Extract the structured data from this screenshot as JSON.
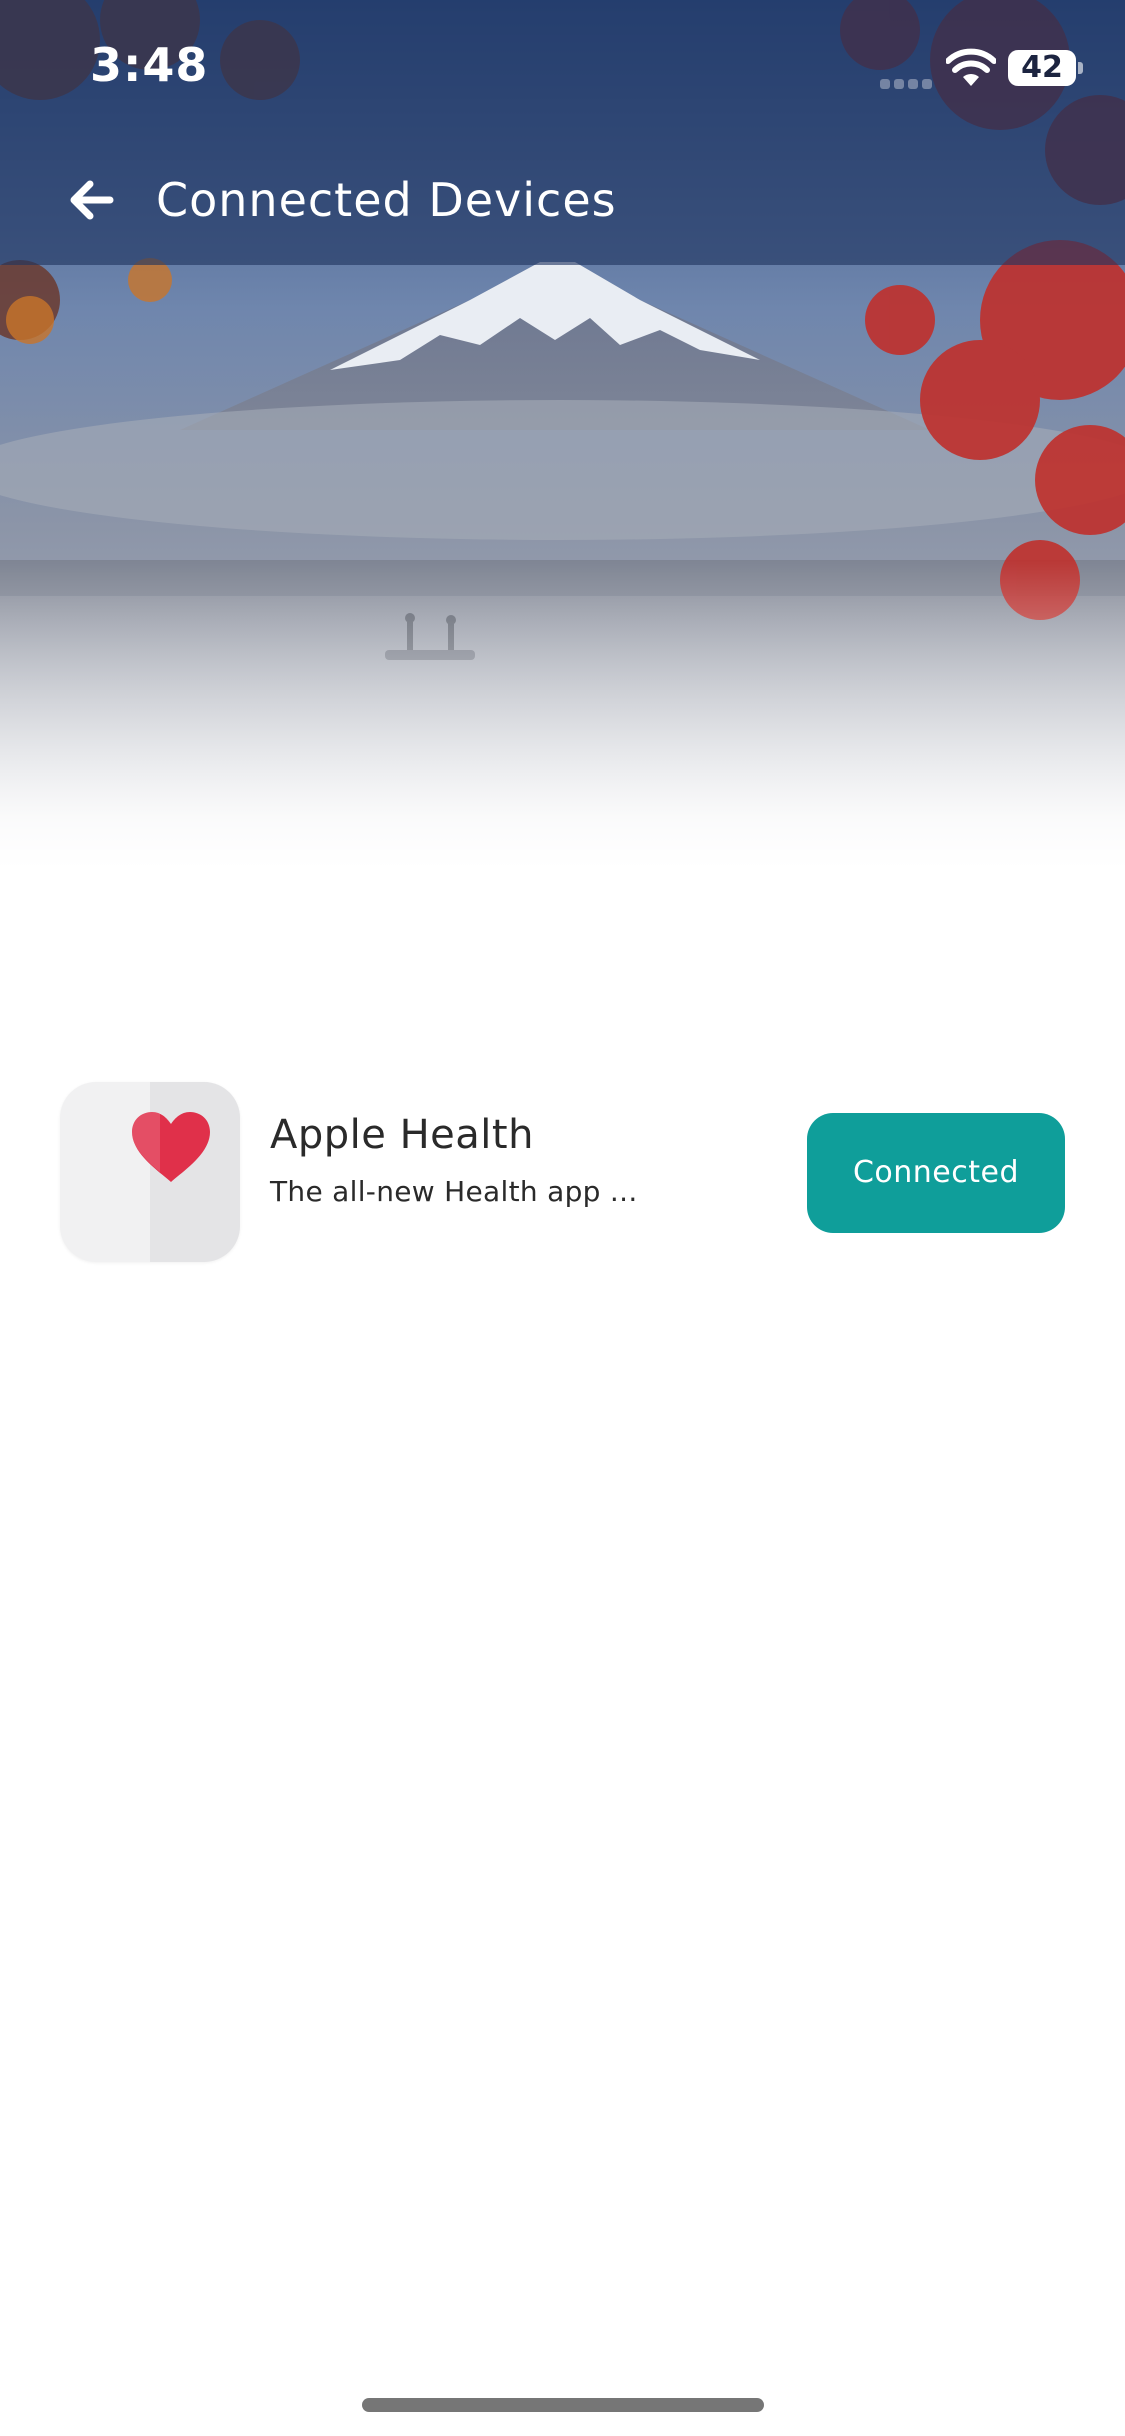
{
  "status_bar": {
    "time": "3:48",
    "battery_level": "42",
    "icons": [
      "cellular-signal-icon",
      "wifi-icon",
      "battery-icon"
    ]
  },
  "header": {
    "title": "Connected Devices",
    "back_icon": "arrow-left-icon"
  },
  "devices": [
    {
      "name": "Apple Health",
      "description": "The all-new Health app ...",
      "icon": "heart-icon",
      "button_label": "Connected"
    }
  ],
  "colors": {
    "accent": "#0f9e9a",
    "header_overlay": "#1e3460",
    "heart": "#e0304a",
    "text": "#2a2a2a"
  }
}
